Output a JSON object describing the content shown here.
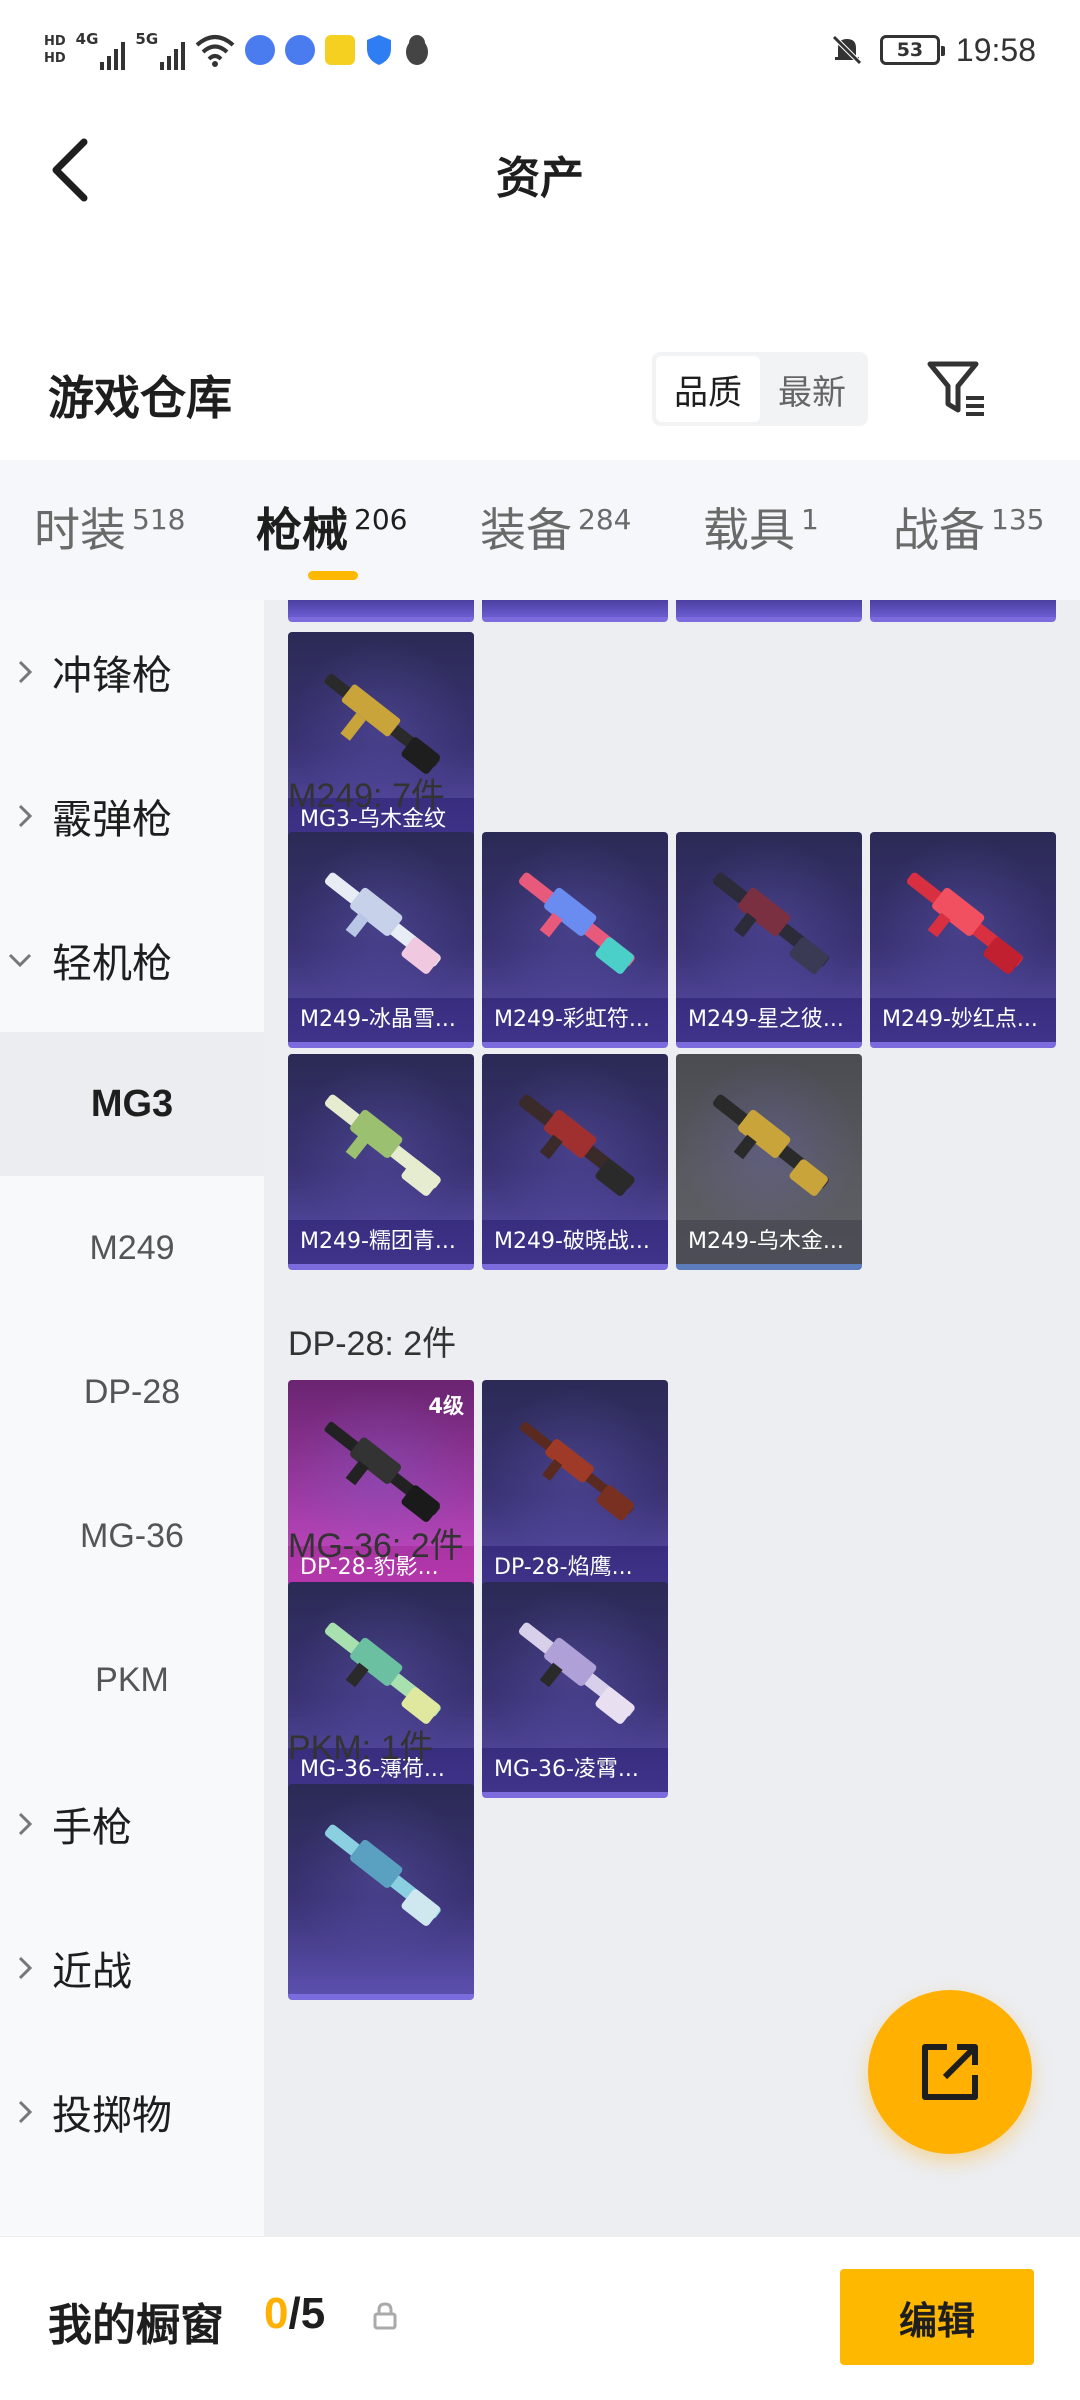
{
  "status_bar": {
    "hd_top": "HD",
    "hd_bottom": "HD",
    "net1": "4G",
    "net2": "5G",
    "battery": "53",
    "time": "19:58"
  },
  "header": {
    "title": "资产"
  },
  "section": {
    "title": "游戏仓库",
    "sort_options": [
      "品质",
      "最新"
    ],
    "sort_selected": "品质"
  },
  "tabs": [
    {
      "label": "时装",
      "count": "518"
    },
    {
      "label": "枪械",
      "count": "206"
    },
    {
      "label": "装备",
      "count": "284"
    },
    {
      "label": "载具",
      "count": "1"
    },
    {
      "label": "战备",
      "count": "135"
    }
  ],
  "sidebar": {
    "groups": [
      {
        "label": "冲锋枪"
      },
      {
        "label": "霰弹枪"
      },
      {
        "label": "轻机枪"
      }
    ],
    "subitems": [
      {
        "label": "MG3"
      },
      {
        "label": "M249"
      },
      {
        "label": "DP-28"
      },
      {
        "label": "MG-36"
      },
      {
        "label": "PKM"
      }
    ],
    "groups_after": [
      {
        "label": "手枪"
      },
      {
        "label": "近战"
      },
      {
        "label": "投掷物"
      }
    ]
  },
  "content": {
    "mg3_items": [
      "MG3-乌木金纹"
    ],
    "m249_title": "M249: 7件",
    "m249_items": [
      "M249-冰晶雪...",
      "M249-彩虹符...",
      "M249-星之彼...",
      "M249-妙红点...",
      "M249-糯团青...",
      "M249-破晓战...",
      "M249-乌木金..."
    ],
    "dp28_title": "DP-28: 2件",
    "dp28_items": [
      "DP-28-豹影...",
      "DP-28-焰鹰..."
    ],
    "dp28_level": "4级",
    "mg36_title": "MG-36: 2件",
    "mg36_items": [
      "MG-36-薄荷...",
      "MG-36-凌霄..."
    ],
    "pkm_title": "PKM: 1件"
  },
  "bottom_bar": {
    "label": "我的橱窗",
    "current": "0",
    "separator": "/",
    "total": "5",
    "edit_label": "编辑"
  },
  "colors": {
    "accent": "#ffb800",
    "card_purple": "#3a3374",
    "card_pink": "#9b3aa3",
    "card_gray": "#55565c"
  }
}
